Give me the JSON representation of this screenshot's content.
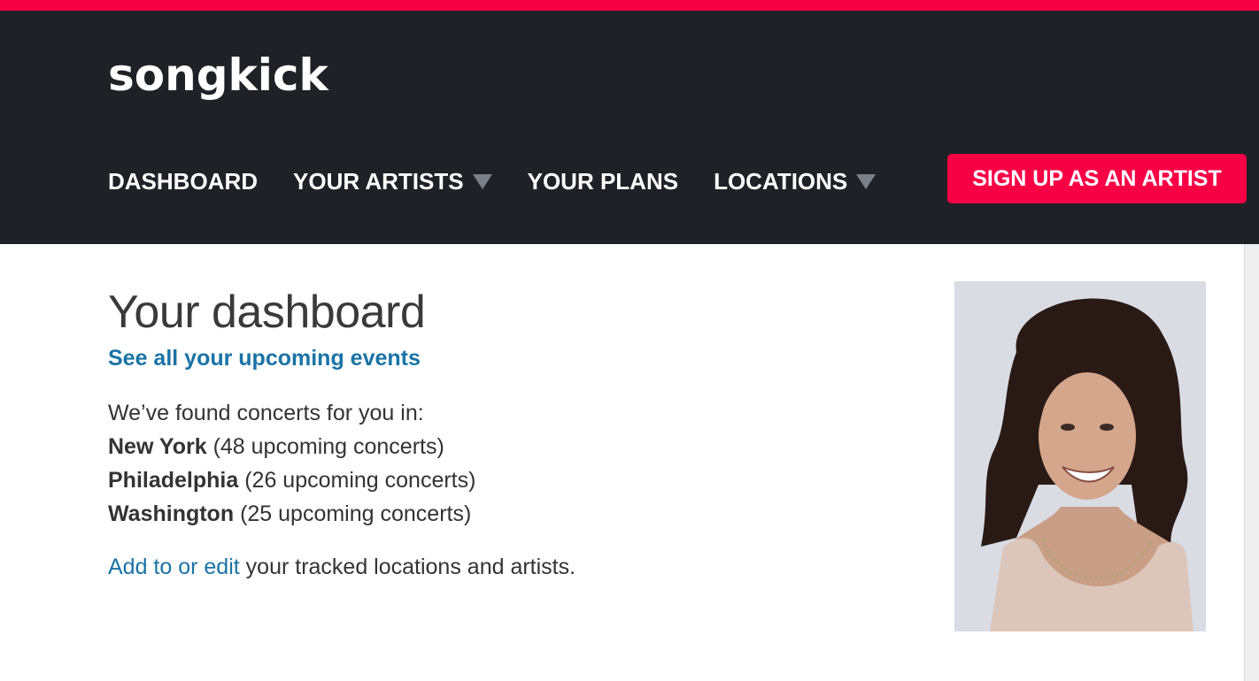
{
  "brand": {
    "name": "songkick",
    "accent": "#f80046",
    "header_bg": "#1f2127",
    "link": "#1a73a6"
  },
  "nav": {
    "items": [
      {
        "label": "DASHBOARD",
        "dropdown": false
      },
      {
        "label": "YOUR ARTISTS",
        "dropdown": true
      },
      {
        "label": "YOUR PLANS",
        "dropdown": false
      },
      {
        "label": "LOCATIONS",
        "dropdown": true
      }
    ],
    "signup_label": "SIGN UP AS AN ARTIST"
  },
  "main": {
    "title": "Your dashboard",
    "events_link": "See all your upcoming events",
    "found_text": "We’ve found concerts for you in:",
    "locations": [
      {
        "city": "New York",
        "count": "(48 upcoming concerts)"
      },
      {
        "city": "Philadelphia",
        "count": "(26 upcoming concerts)"
      },
      {
        "city": "Washington",
        "count": "(25 upcoming concerts)"
      }
    ],
    "edit_link": "Add to or edit",
    "edit_suffix": " your tracked locations and artists."
  },
  "profile": {
    "photo_icon": "user-photo"
  }
}
